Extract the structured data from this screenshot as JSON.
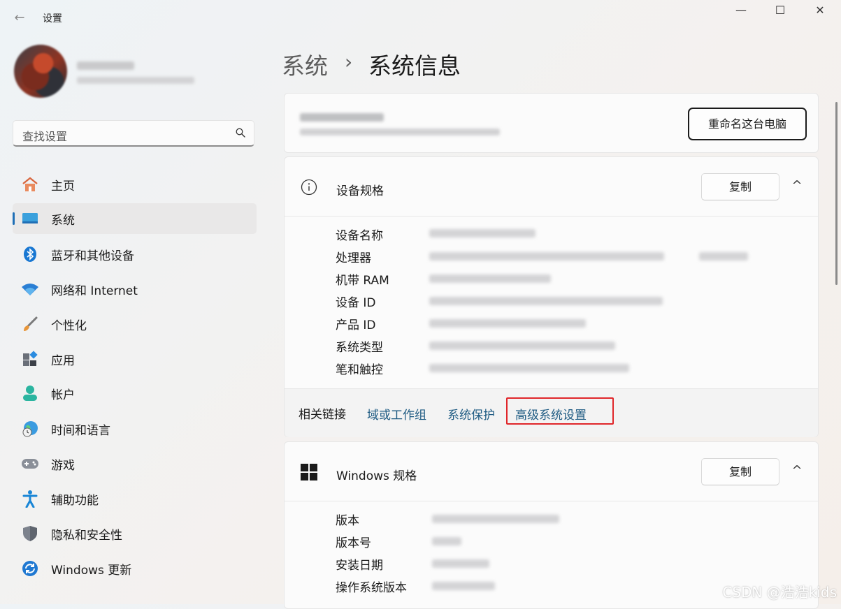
{
  "window": {
    "title": "设置",
    "controls": {
      "minimize": "—",
      "maximize": "☐",
      "close": "✕"
    }
  },
  "search": {
    "placeholder": "查找设置"
  },
  "nav": [
    {
      "label": "主页",
      "icon": "home-icon"
    },
    {
      "label": "系统",
      "icon": "monitor-icon",
      "active": true
    },
    {
      "label": "蓝牙和其他设备",
      "icon": "bluetooth-icon"
    },
    {
      "label": "网络和 Internet",
      "icon": "wifi-icon"
    },
    {
      "label": "个性化",
      "icon": "brush-icon"
    },
    {
      "label": "应用",
      "icon": "apps-icon"
    },
    {
      "label": "帐户",
      "icon": "account-icon"
    },
    {
      "label": "时间和语言",
      "icon": "globe-clock-icon"
    },
    {
      "label": "游戏",
      "icon": "gamepad-icon"
    },
    {
      "label": "辅助功能",
      "icon": "accessibility-icon"
    },
    {
      "label": "隐私和安全性",
      "icon": "shield-icon"
    },
    {
      "label": "Windows 更新",
      "icon": "update-icon"
    }
  ],
  "breadcrumb": {
    "parent": "系统",
    "separator": "›",
    "current": "系统信息"
  },
  "device_card": {
    "rename_button": "重命名这台电脑"
  },
  "device_specs": {
    "title": "设备规格",
    "copy_button": "复制",
    "rows": [
      "设备名称",
      "处理器",
      "机带 RAM",
      "设备 ID",
      "产品 ID",
      "系统类型",
      "笔和触控"
    ]
  },
  "related_links": {
    "label": "相关链接",
    "links": [
      "域或工作组",
      "系统保护",
      "高级系统设置"
    ],
    "highlight_color": "#e0262a"
  },
  "windows_specs": {
    "title": "Windows 规格",
    "copy_button": "复制",
    "rows": [
      "版本",
      "版本号",
      "安装日期",
      "操作系统版本"
    ]
  },
  "watermark": "CSDN @浩浩kids",
  "colors": {
    "accent": "#1f6fb6",
    "link": "#1d5a82"
  }
}
